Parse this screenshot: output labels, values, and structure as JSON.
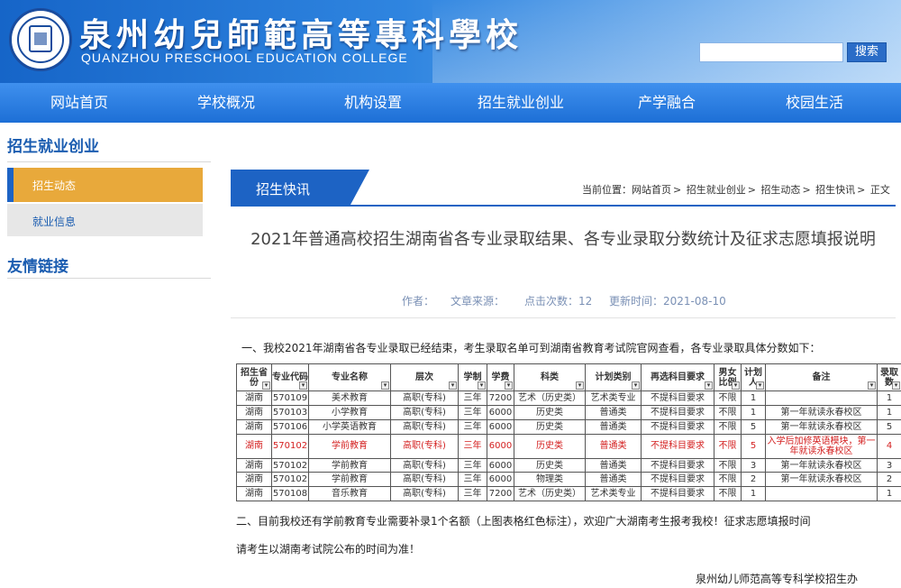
{
  "header": {
    "title_cn": "泉州幼兒師範高等專科學校",
    "title_en": "QUANZHOU PRESCHOOL EDUCATION COLLEGE",
    "search_button": "搜索",
    "logo_icon": "school-seal-icon"
  },
  "nav": [
    "网站首页",
    "学校概况",
    "机构设置",
    "招生就业创业",
    "产学融合",
    "校园生活"
  ],
  "sidebar": {
    "title": "招生就业创业",
    "items": [
      "招生动态",
      "就业信息"
    ],
    "friends_title": "友情链接"
  },
  "section_tab": "招生快讯",
  "breadcrumb": [
    "当前位置：网站首页",
    "招生就业创业",
    "招生动态",
    "招生快讯",
    "正文"
  ],
  "article": {
    "title": "2021年普通高校招生湖南省各专业录取结果、各专业录取分数统计及征求志愿填报说明",
    "author_label": "作者：",
    "source_label": "文章来源：",
    "clicks": "点击次数：12",
    "updated": "更新时间：2021-08-10",
    "p1": "一、我校2021年湖南省各专业录取已经结束，考生录取名单可到湖南省教育考试院官网查看，各专业录取具体分数如下：",
    "p2": "二、目前我校还有学前教育专业需要补录1个名额（上图表格红色标注），欢迎广大湖南考生报考我校！征求志愿填报时间",
    "p3": "请考生以湖南考试院公布的时间为准！",
    "signature": "泉州幼儿师范高等专科学校招生办"
  },
  "table": {
    "headers": [
      "招生省份",
      "专业代码",
      "专业名称",
      "层次",
      "学制",
      "学费",
      "科类",
      "计划类别",
      "再选科目要求",
      "男女比例",
      "计划人",
      "备注",
      "录取数"
    ],
    "rows": [
      [
        "湖南",
        "570109",
        "美术教育",
        "高职(专科)",
        "三年",
        "7200",
        "艺术（历史类）",
        "艺术类专业",
        "不提科目要求",
        "不限",
        "1",
        "",
        "1"
      ],
      [
        "湖南",
        "570103",
        "小学教育",
        "高职(专科)",
        "三年",
        "6000",
        "历史类",
        "普通类",
        "不提科目要求",
        "不限",
        "1",
        "第一年就读永春校区",
        "1"
      ],
      [
        "湖南",
        "570106",
        "小学英语教育",
        "高职(专科)",
        "三年",
        "6000",
        "历史类",
        "普通类",
        "不提科目要求",
        "不限",
        "5",
        "第一年就读永春校区",
        "5"
      ],
      [
        "湖南",
        "570102",
        "学前教育",
        "高职(专科)",
        "三年",
        "6000",
        "历史类",
        "普通类",
        "不提科目要求",
        "不限",
        "5",
        "入学后加修英语模块，第一年就读永春校区",
        "4"
      ],
      [
        "湖南",
        "570102",
        "学前教育",
        "高职(专科)",
        "三年",
        "6000",
        "历史类",
        "普通类",
        "不提科目要求",
        "不限",
        "3",
        "第一年就读永春校区",
        "3"
      ],
      [
        "湖南",
        "570102",
        "学前教育",
        "高职(专科)",
        "三年",
        "6000",
        "物理类",
        "普通类",
        "不提科目要求",
        "不限",
        "2",
        "第一年就读永春校区",
        "2"
      ],
      [
        "湖南",
        "570108",
        "音乐教育",
        "高职(专科)",
        "三年",
        "7200",
        "艺术（历史类）",
        "艺术类专业",
        "不提科目要求",
        "不限",
        "1",
        "",
        "1"
      ]
    ]
  },
  "colors": {
    "nav_blue": "#1d6fd6",
    "accent_orange": "#e8a93b",
    "highlight_red": "#d42020"
  }
}
